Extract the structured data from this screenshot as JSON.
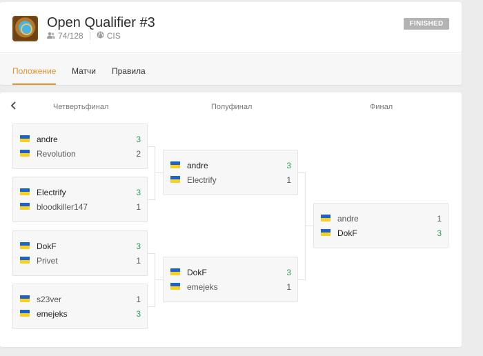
{
  "tournament": {
    "title": "Open Qualifier #3",
    "participants": "74/128",
    "region": "CIS",
    "status": "FINISHED",
    "game_logo_icon": "hearthstone-logo-icon",
    "participants_icon": "users-icon",
    "region_icon": "globe-icon"
  },
  "tabs": [
    {
      "label": "Положение",
      "active": true
    },
    {
      "label": "Матчи",
      "active": false
    },
    {
      "label": "Правила",
      "active": false
    }
  ],
  "bracket": {
    "back_icon": "chevron-left-icon",
    "rounds": [
      "Четвертьфинал",
      "Полуфинал",
      "Финал"
    ],
    "flag_icon": "flag-ukraine-icon",
    "colors": {
      "accent": "#e0922a",
      "win_score": "#2e9d58",
      "badge": "#b3b3b3"
    },
    "quarterfinals": [
      {
        "p1": {
          "name": "andre",
          "score": "3",
          "win": true
        },
        "p2": {
          "name": "Revolution",
          "score": "2",
          "win": false
        }
      },
      {
        "p1": {
          "name": "Electrify",
          "score": "3",
          "win": true
        },
        "p2": {
          "name": "bloodkiller147",
          "score": "1",
          "win": false
        }
      },
      {
        "p1": {
          "name": "DokF",
          "score": "3",
          "win": true
        },
        "p2": {
          "name": "Privet",
          "score": "1",
          "win": false
        }
      },
      {
        "p1": {
          "name": "s23ver",
          "score": "1",
          "win": false
        },
        "p2": {
          "name": "emejeks",
          "score": "3",
          "win": true
        }
      }
    ],
    "semifinals": [
      {
        "p1": {
          "name": "andre",
          "score": "3",
          "win": true
        },
        "p2": {
          "name": "Electrify",
          "score": "1",
          "win": false
        }
      },
      {
        "p1": {
          "name": "DokF",
          "score": "3",
          "win": true
        },
        "p2": {
          "name": "emejeks",
          "score": "1",
          "win": false
        }
      }
    ],
    "final": [
      {
        "p1": {
          "name": "andre",
          "score": "1",
          "win": false
        },
        "p2": {
          "name": "DokF",
          "score": "3",
          "win": true
        }
      }
    ]
  }
}
